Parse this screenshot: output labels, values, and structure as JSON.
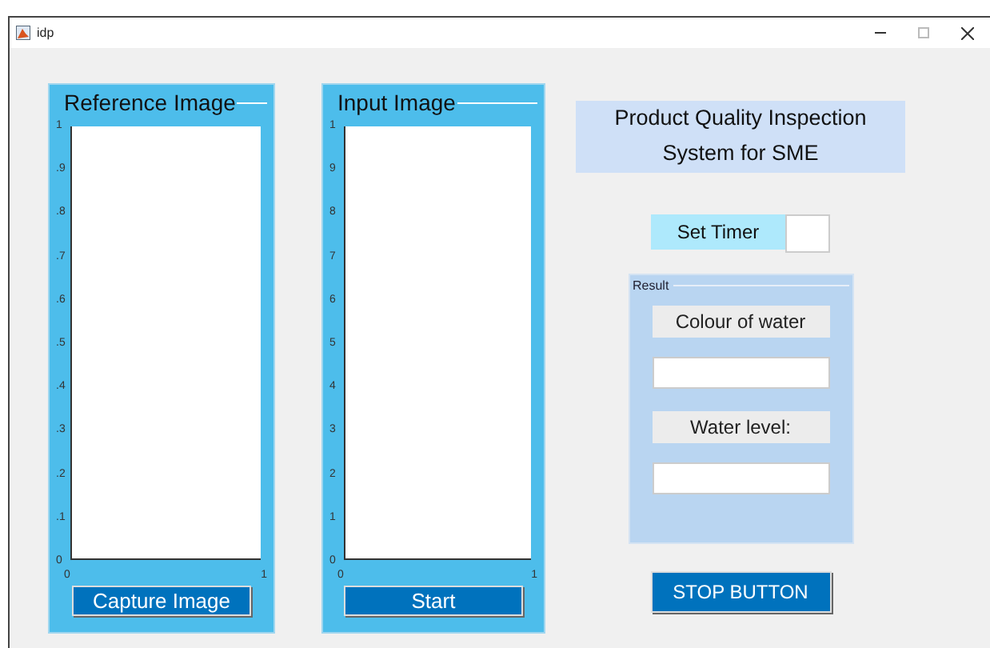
{
  "window": {
    "title": "idp"
  },
  "panels": [
    {
      "title": "Reference Image",
      "y_ticks": [
        "1",
        ".9",
        ".8",
        ".7",
        ".6",
        ".5",
        ".4",
        ".3",
        ".2",
        ".1",
        "0"
      ],
      "x_ticks": [
        "0",
        "1"
      ],
      "button": "Capture Image"
    },
    {
      "title": "Input Image",
      "y_ticks": [
        "1",
        "9",
        "8",
        "7",
        "6",
        "5",
        "4",
        "3",
        "2",
        "1",
        "0"
      ],
      "x_ticks": [
        "0",
        "1"
      ],
      "button": "Start"
    }
  ],
  "heading": "Product Quality Inspection System for SME",
  "timer": {
    "label": "Set Timer"
  },
  "result": {
    "title": "Result",
    "fields": [
      {
        "label": "Colour of water"
      },
      {
        "label": "Water level:"
      }
    ]
  },
  "stop_button": "STOP BUTTON"
}
